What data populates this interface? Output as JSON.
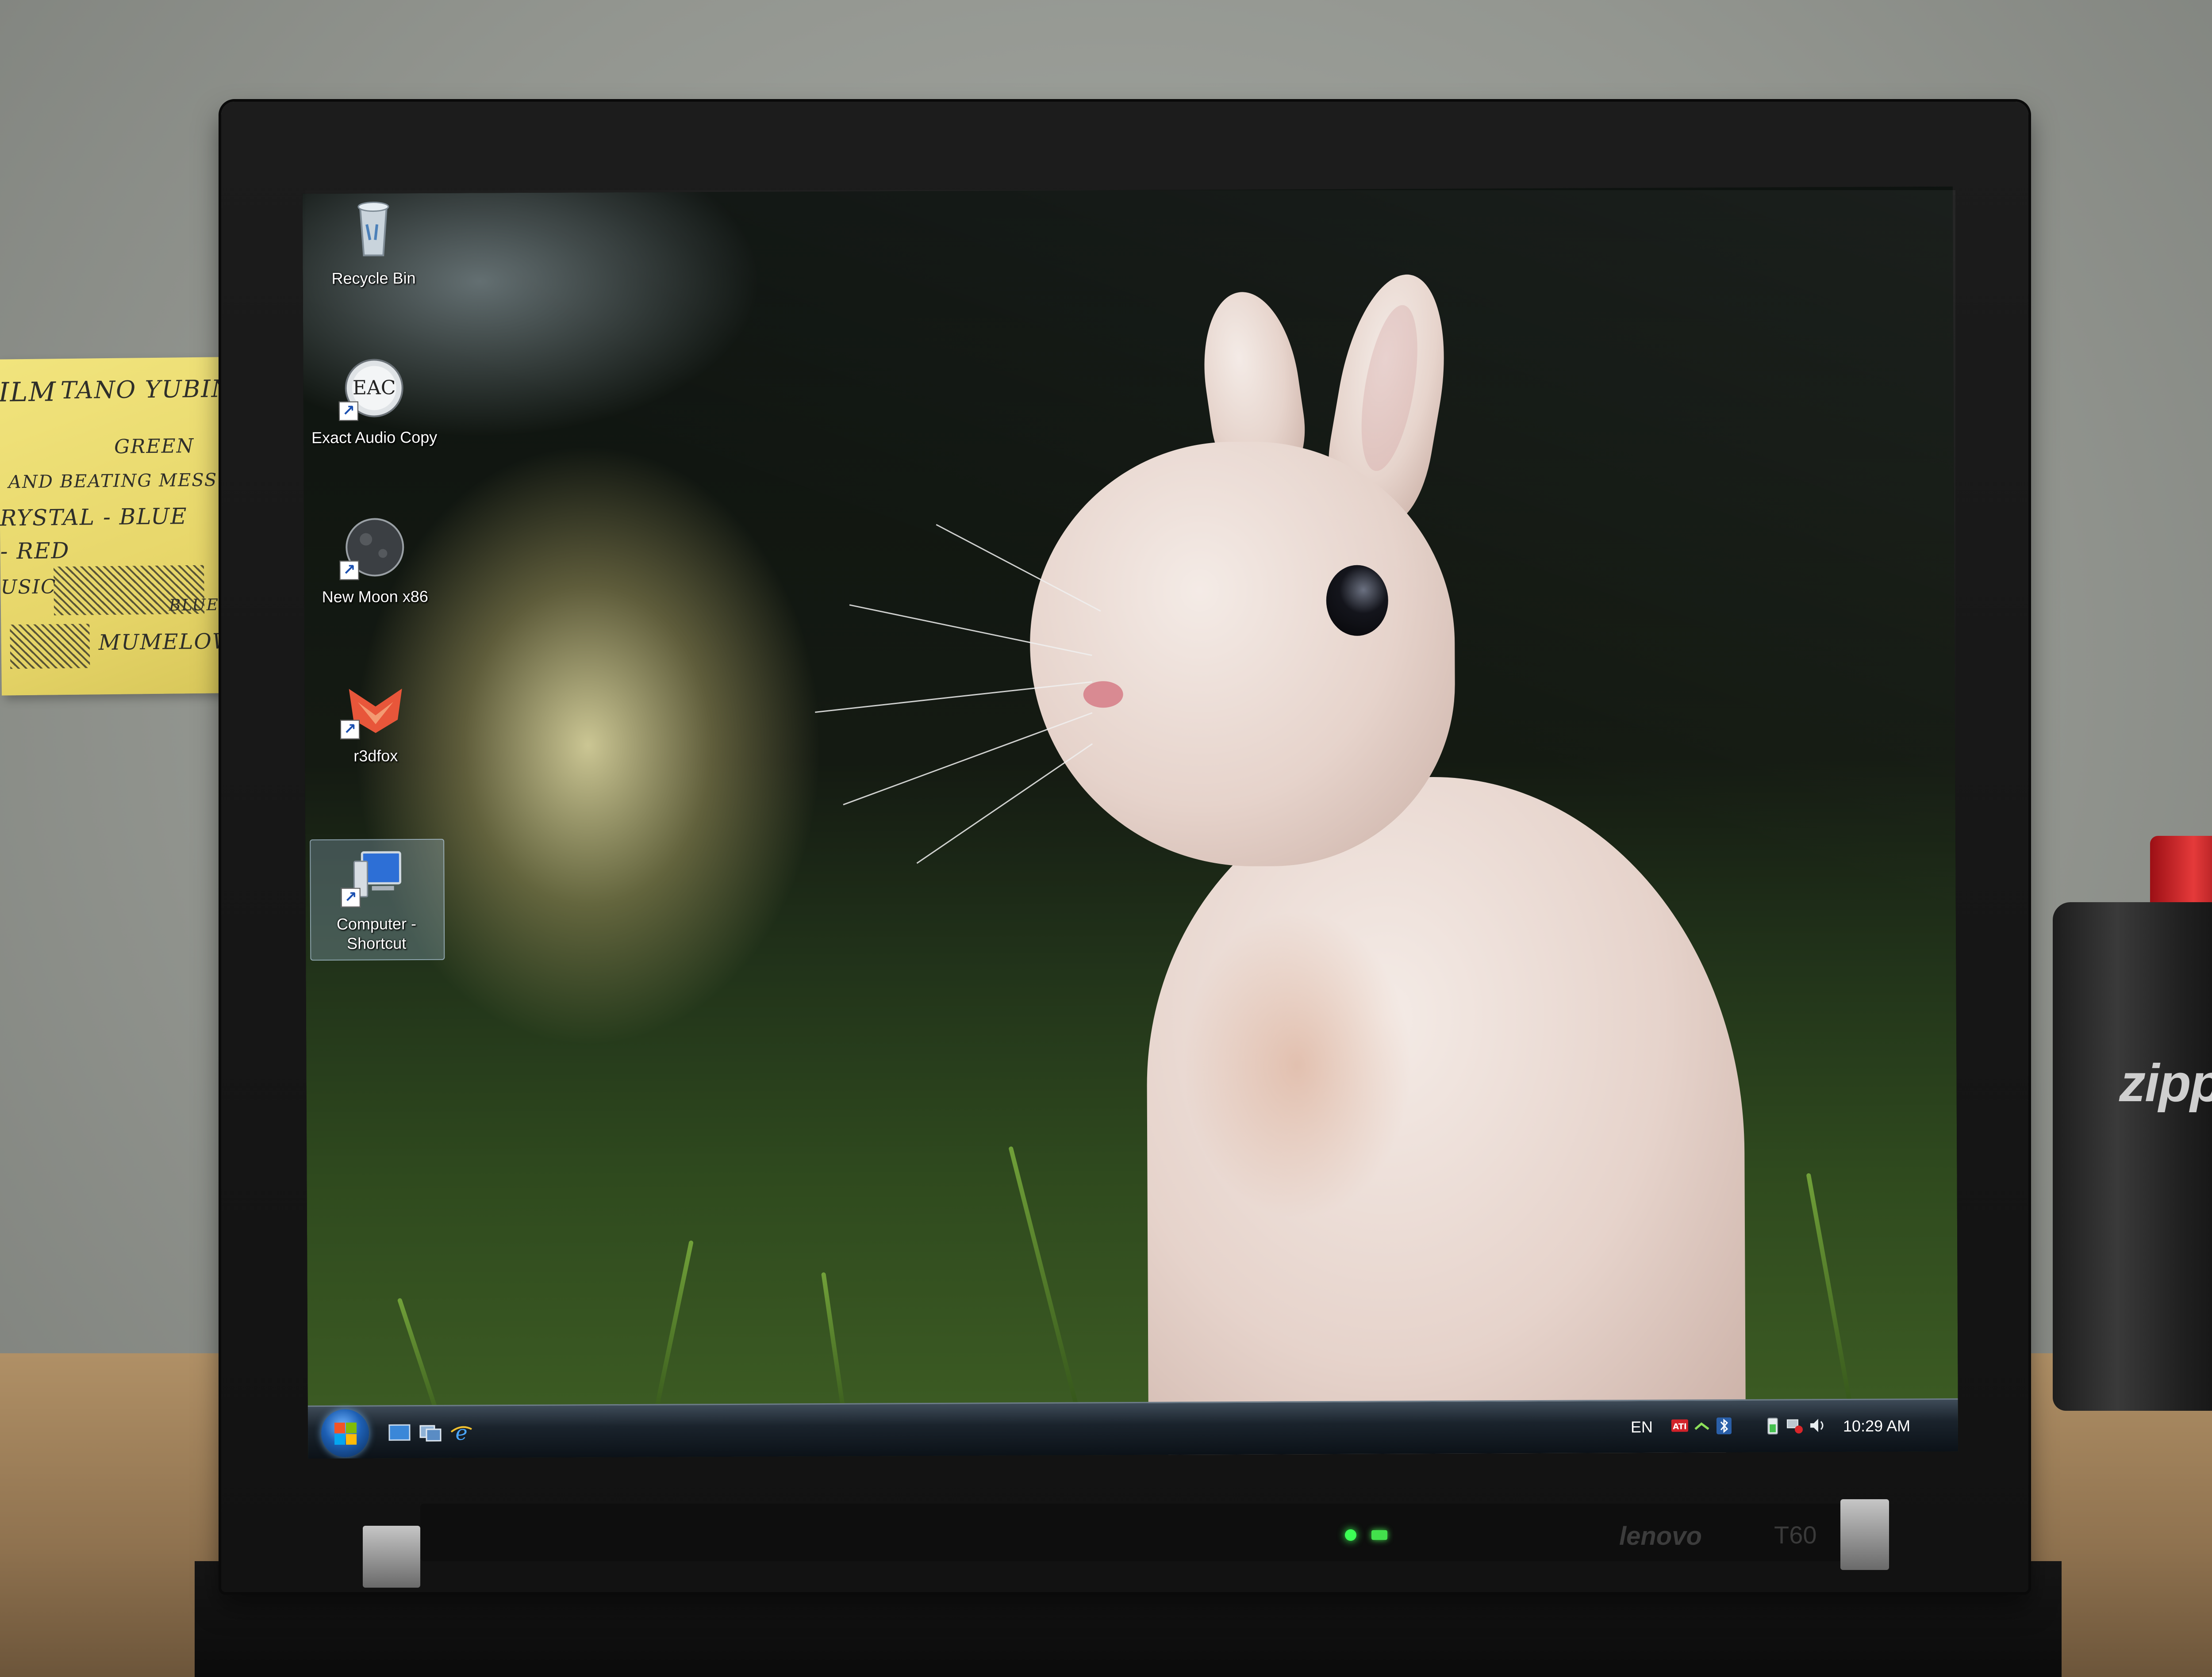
{
  "desktop": {
    "icons": [
      {
        "label": "Recycle Bin",
        "icon": "recycle-bin-icon"
      },
      {
        "label": "Exact Audio Copy",
        "icon": "eac-icon",
        "glyph_text": "EAC"
      },
      {
        "label": "New Moon x86",
        "icon": "new-moon-icon"
      },
      {
        "label": "r3dfox",
        "icon": "r3dfox-icon"
      },
      {
        "label": "Computer - Shortcut",
        "icon": "computer-icon",
        "selected": true
      }
    ]
  },
  "taskbar": {
    "start_icon": "windows-start-orb",
    "quick_launch": [
      "show-desktop-icon",
      "switch-windows-icon",
      "internet-explorer-icon"
    ],
    "language": "EN",
    "tray_icons": [
      "ati-catalyst-icon",
      "network-icon",
      "bluetooth-icon",
      "battery-icon",
      "network-status-icon",
      "volume-icon"
    ],
    "clock": "10:29 AM"
  },
  "hardware": {
    "brand": "lenovo",
    "model": "T60"
  },
  "surroundings": {
    "sticky_note_lines": [
      "ILM",
      "TANO YUBIN",
      "GREEN",
      "AND BEATING MESS",
      "RYSTAL - BLUE",
      "- RED",
      "USIC",
      "BLUE",
      "MUMELOW"
    ],
    "lighter_brand": "zippo"
  },
  "colors": {
    "taskbar_top": "#3e4b58",
    "taskbar_bottom": "#0b1117",
    "selection": "#aac8eb",
    "power_led": "#3cff55"
  }
}
